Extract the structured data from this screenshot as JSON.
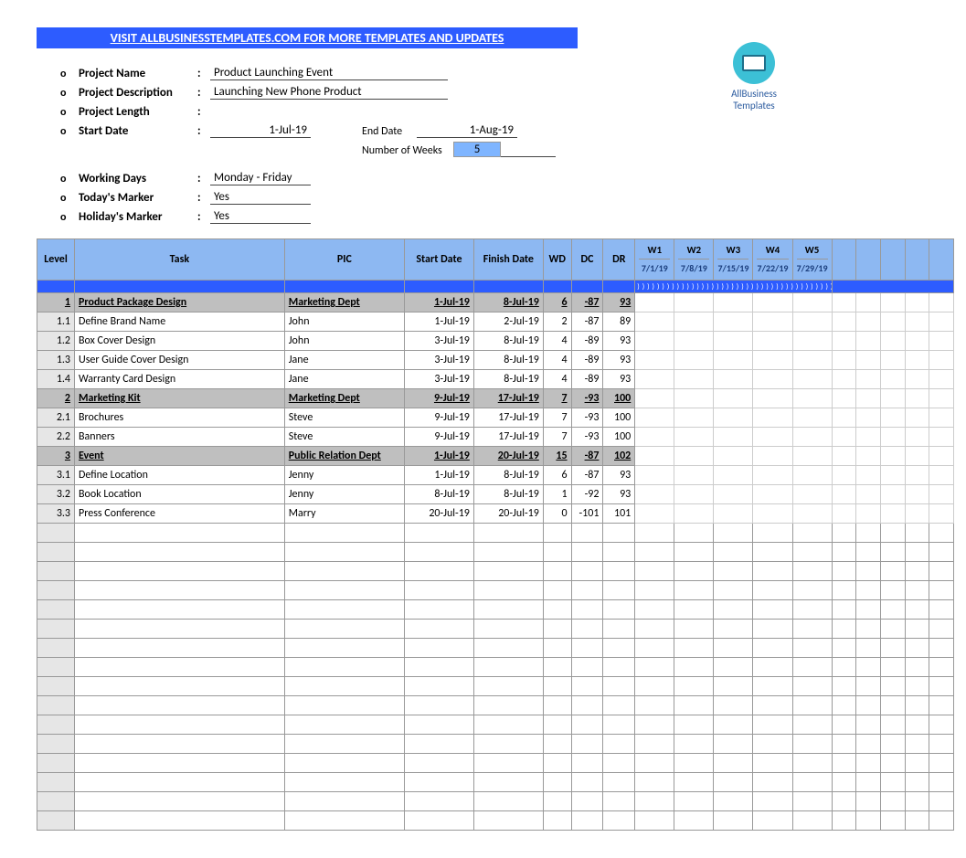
{
  "header": {
    "title": "VISIT ALLBUSINESSTEMPLATES.COM FOR MORE TEMPLATES AND UPDATES"
  },
  "logo": {
    "name": "AllBusiness Templates"
  },
  "info": {
    "project_name_label": "Project Name",
    "project_name": "Product Launching Event",
    "project_desc_label": "Project Description",
    "project_desc": "Launching New Phone Product",
    "project_length_label": "Project Length",
    "project_length": "",
    "start_date_label": "Start Date",
    "start_date": "1-Jul-19",
    "end_date_label": "End Date",
    "end_date": "1-Aug-19",
    "num_weeks_label": "Number of Weeks",
    "num_weeks": "5",
    "working_days_label": "Working Days",
    "working_days": "Monday - Friday",
    "today_marker_label": "Today's Marker",
    "today_marker": "Yes",
    "holiday_marker_label": "Holiday's Marker",
    "holiday_marker": "Yes"
  },
  "columns": {
    "level": "Level",
    "task": "Task",
    "pic": "PIC",
    "start": "Start Date",
    "finish": "Finish Date",
    "wd": "WD",
    "dc": "DC",
    "dr": "DR"
  },
  "weeks": [
    {
      "w": "W1",
      "d": "7/1/19"
    },
    {
      "w": "W2",
      "d": "7/8/19"
    },
    {
      "w": "W3",
      "d": "7/15/19"
    },
    {
      "w": "W4",
      "d": "7/22/19"
    },
    {
      "w": "W5",
      "d": "7/29/19"
    }
  ],
  "sep_marks": "))))))))))))))))))))))))))))))))))))))))))))))))",
  "rows": [
    {
      "type": "group",
      "level": "1",
      "task": "Product Package Design",
      "pic": "Marketing Dept",
      "start": "1-Jul-19",
      "finish": "8-Jul-19",
      "wd": "6",
      "dc": "-87",
      "dr": "93"
    },
    {
      "type": "row",
      "level": "1.1",
      "task": "Define Brand Name",
      "pic": "John",
      "start": "1-Jul-19",
      "finish": "2-Jul-19",
      "wd": "2",
      "dc": "-87",
      "dr": "89"
    },
    {
      "type": "row",
      "level": "1.2",
      "task": "Box Cover Design",
      "pic": "John",
      "start": "3-Jul-19",
      "finish": "8-Jul-19",
      "wd": "4",
      "dc": "-89",
      "dr": "93"
    },
    {
      "type": "row",
      "level": "1.3",
      "task": "User Guide Cover Design",
      "pic": "Jane",
      "start": "3-Jul-19",
      "finish": "8-Jul-19",
      "wd": "4",
      "dc": "-89",
      "dr": "93"
    },
    {
      "type": "row",
      "level": "1.4",
      "task": "Warranty Card Design",
      "pic": "Jane",
      "start": "3-Jul-19",
      "finish": "8-Jul-19",
      "wd": "4",
      "dc": "-89",
      "dr": "93"
    },
    {
      "type": "group",
      "level": "2",
      "task": "Marketing Kit",
      "pic": "Marketing Dept",
      "start": "9-Jul-19",
      "finish": "17-Jul-19",
      "wd": "7",
      "dc": "-93",
      "dr": "100"
    },
    {
      "type": "row",
      "level": "2.1",
      "task": "Brochures",
      "pic": "Steve",
      "start": "9-Jul-19",
      "finish": "17-Jul-19",
      "wd": "7",
      "dc": "-93",
      "dr": "100"
    },
    {
      "type": "row",
      "level": "2.2",
      "task": "Banners",
      "pic": "Steve",
      "start": "9-Jul-19",
      "finish": "17-Jul-19",
      "wd": "7",
      "dc": "-93",
      "dr": "100"
    },
    {
      "type": "group",
      "level": "3",
      "task": "Event",
      "pic": "Public Relation Dept",
      "start": "1-Jul-19",
      "finish": "20-Jul-19",
      "wd": "15",
      "dc": "-87",
      "dr": "102"
    },
    {
      "type": "row",
      "level": "3.1",
      "task": "Define Location",
      "pic": "Jenny",
      "start": "1-Jul-19",
      "finish": "8-Jul-19",
      "wd": "6",
      "dc": "-87",
      "dr": "93"
    },
    {
      "type": "row",
      "level": "3.2",
      "task": "Book Location",
      "pic": "Jenny",
      "start": "8-Jul-19",
      "finish": "8-Jul-19",
      "wd": "1",
      "dc": "-92",
      "dr": "93"
    },
    {
      "type": "row",
      "level": "3.3",
      "task": "Press Conference",
      "pic": "Marry",
      "start": "20-Jul-19",
      "finish": "20-Jul-19",
      "wd": "0",
      "dc": "-101",
      "dr": "101"
    }
  ],
  "empty_rows": 16
}
